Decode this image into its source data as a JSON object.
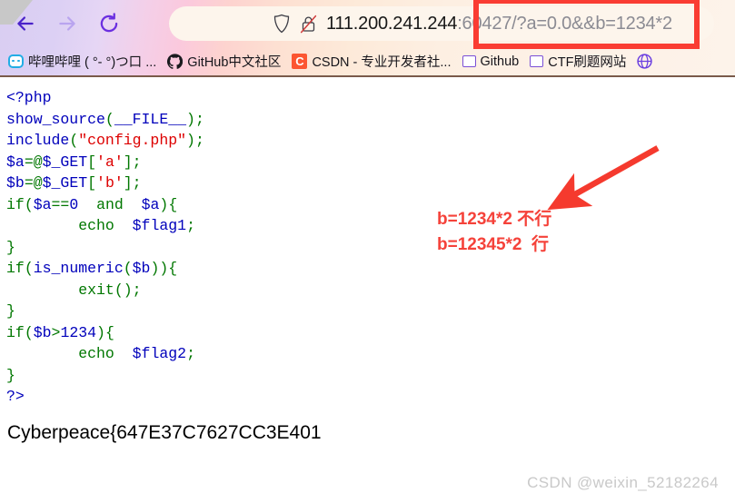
{
  "browser": {
    "nav": {
      "back_label": "Back",
      "forward_label": "Forward",
      "reload_label": "Reload"
    },
    "urlbar": {
      "shield_icon": "shield-icon",
      "lock_icon": "lock-crossed-out-icon",
      "host": "111.200.241.244",
      "rest": ":60427/?a=0.0&&b=1234*2",
      "full_url": "111.200.241.244:60427/?a=0.0&&b=1234*2"
    },
    "bookmarks": [
      {
        "label": "哔哩哔哩 ( °- °)つ口 ...",
        "icon": "bilibili-icon"
      },
      {
        "label": "GitHub中文社区",
        "icon": "github-icon"
      },
      {
        "label": "CSDN - 专业开发者社...",
        "icon": "csdn-icon"
      },
      {
        "label": "Github",
        "icon": "blank-page-icon"
      },
      {
        "label": "CTF刷题网站",
        "icon": "blank-page-icon"
      },
      {
        "label": "",
        "icon": "globe-icon"
      }
    ]
  },
  "page": {
    "code": [
      [
        {
          "t": "<?php",
          "c": "kw"
        }
      ],
      [
        {
          "t": "show_source",
          "c": "kw"
        },
        {
          "t": "(",
          "c": "op"
        },
        {
          "t": "__FILE__",
          "c": "kw"
        },
        {
          "t": ")",
          "c": "op"
        },
        {
          "t": ";",
          "c": "op"
        }
      ],
      [
        {
          "t": "include",
          "c": "kw"
        },
        {
          "t": "(",
          "c": "op"
        },
        {
          "t": "\"config.php\"",
          "c": "str"
        },
        {
          "t": ")",
          "c": "op"
        },
        {
          "t": ";",
          "c": "op"
        }
      ],
      [
        {
          "t": "$a",
          "c": "kw"
        },
        {
          "t": "=@",
          "c": "op"
        },
        {
          "t": "$_GET",
          "c": "kw"
        },
        {
          "t": "[",
          "c": "op"
        },
        {
          "t": "'a'",
          "c": "str"
        },
        {
          "t": "]",
          "c": "op"
        },
        {
          "t": ";",
          "c": "op"
        }
      ],
      [
        {
          "t": "$b",
          "c": "kw"
        },
        {
          "t": "=@",
          "c": "op"
        },
        {
          "t": "$_GET",
          "c": "kw"
        },
        {
          "t": "[",
          "c": "op"
        },
        {
          "t": "'b'",
          "c": "str"
        },
        {
          "t": "]",
          "c": "op"
        },
        {
          "t": ";",
          "c": "op"
        }
      ],
      [
        {
          "t": "if",
          "c": "op"
        },
        {
          "t": "(",
          "c": "op"
        },
        {
          "t": "$a",
          "c": "kw"
        },
        {
          "t": "==",
          "c": "op"
        },
        {
          "t": "0",
          "c": "kw"
        },
        {
          "t": "  ",
          "c": "op"
        },
        {
          "t": "and",
          "c": "op"
        },
        {
          "t": "  ",
          "c": "op"
        },
        {
          "t": "$a",
          "c": "kw"
        },
        {
          "t": ")",
          "c": "op"
        },
        {
          "t": "{",
          "c": "op"
        }
      ],
      [
        {
          "t": "        ",
          "c": "op"
        },
        {
          "t": "echo",
          "c": "op"
        },
        {
          "t": "  ",
          "c": "op"
        },
        {
          "t": "$flag1",
          "c": "kw"
        },
        {
          "t": ";",
          "c": "op"
        }
      ],
      [
        {
          "t": "}",
          "c": "op"
        }
      ],
      [
        {
          "t": "if",
          "c": "op"
        },
        {
          "t": "(",
          "c": "op"
        },
        {
          "t": "is_numeric",
          "c": "kw"
        },
        {
          "t": "(",
          "c": "op"
        },
        {
          "t": "$b",
          "c": "kw"
        },
        {
          "t": ")",
          "c": "op"
        },
        {
          "t": ")",
          "c": "op"
        },
        {
          "t": "{",
          "c": "op"
        }
      ],
      [
        {
          "t": "        ",
          "c": "op"
        },
        {
          "t": "exit",
          "c": "op"
        },
        {
          "t": "(",
          "c": "op"
        },
        {
          "t": ")",
          "c": "op"
        },
        {
          "t": ";",
          "c": "op"
        }
      ],
      [
        {
          "t": "}",
          "c": "op"
        }
      ],
      [
        {
          "t": "if",
          "c": "op"
        },
        {
          "t": "(",
          "c": "op"
        },
        {
          "t": "$b",
          "c": "kw"
        },
        {
          "t": ">",
          "c": "op"
        },
        {
          "t": "1234",
          "c": "kw"
        },
        {
          "t": ")",
          "c": "op"
        },
        {
          "t": "{",
          "c": "op"
        }
      ],
      [
        {
          "t": "        ",
          "c": "op"
        },
        {
          "t": "echo",
          "c": "op"
        },
        {
          "t": "  ",
          "c": "op"
        },
        {
          "t": "$flag2",
          "c": "kw"
        },
        {
          "t": ";",
          "c": "op"
        }
      ],
      [
        {
          "t": "}",
          "c": "op"
        }
      ],
      [
        {
          "t": "?>",
          "c": "kw"
        }
      ]
    ],
    "flag_output": "Cyberpeace{647E37C7627CC3E401"
  },
  "annotations": {
    "url_highlight_box": "red-rectangle-around-query-string",
    "arrow": "red-arrow-pointing-to-url",
    "note_line1": "b=1234*2 不行",
    "note_line2": "b=12345*2  行",
    "colors": {
      "annotation_red": "#f5423a",
      "box_red": "#fa3c32"
    }
  },
  "watermark": "CSDN @weixin_52182264"
}
